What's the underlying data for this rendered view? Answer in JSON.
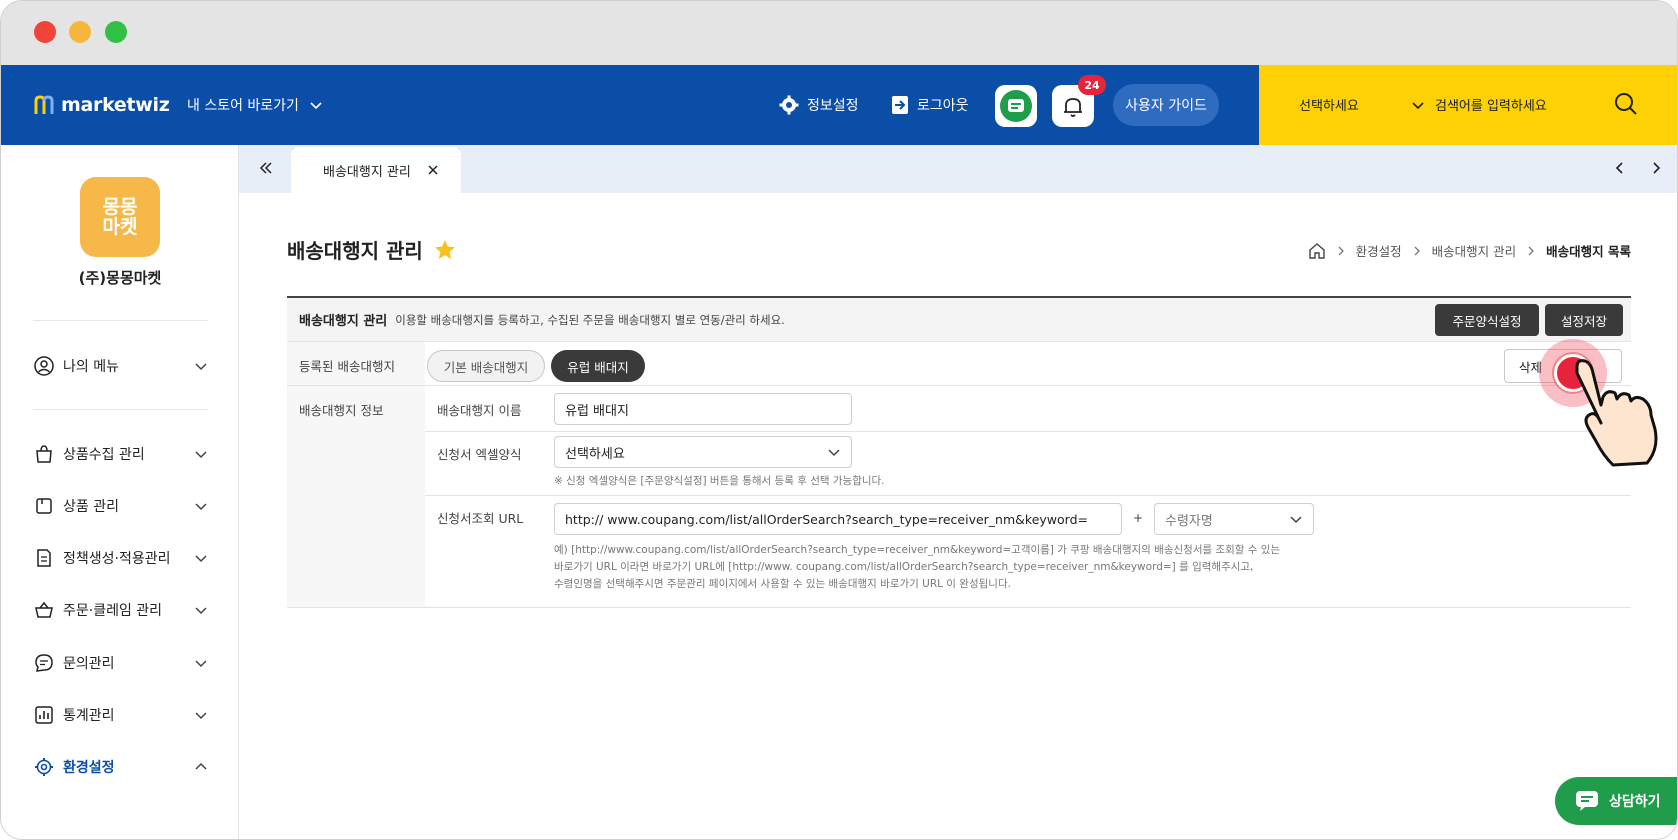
{
  "header": {
    "logo_text": "marketwiz",
    "store_link": "내 스토어 바로가기",
    "info_settings": "정보설정",
    "logout": "로그아웃",
    "notification_count": "24",
    "user_guide": "사용자 가이드",
    "search_select": "선택하세요",
    "search_placeholder": "검색어를 입력하세요"
  },
  "sidebar": {
    "store_logo_text": "몽몽마켓",
    "store_name": "(주)몽몽마켓",
    "my_menu": "나의 메뉴",
    "items": [
      {
        "label": "상품수집 관리",
        "icon": "bag-icon"
      },
      {
        "label": "상품 관리",
        "icon": "box-icon"
      },
      {
        "label": "정책생성·적용관리",
        "icon": "document-icon"
      },
      {
        "label": "주문·클레임 관리",
        "icon": "basket-icon"
      },
      {
        "label": "문의관리",
        "icon": "chat-bubble-icon"
      },
      {
        "label": "통계관리",
        "icon": "bar-chart-icon"
      },
      {
        "label": "환경설정",
        "icon": "gear-icon",
        "active": true
      }
    ]
  },
  "tabs": {
    "active_tab": "배송대행지 관리"
  },
  "page": {
    "title": "배송대행지 관리",
    "breadcrumb": [
      "환경설정",
      "배송대행지 관리",
      "배송대행지 목록"
    ]
  },
  "panel": {
    "heading": "배송대행지 관리",
    "description": "이용할 배송대행지를 등록하고, 수집된 주문을 배송대행지 별로 연동/관리 하세요.",
    "order_format_button": "주문양식설정",
    "save_button": "설정저장",
    "registered_label": "등록된 배송대행지",
    "chip_default": "기본 배송대행지",
    "chip_active": "유럽 배대지",
    "delete_button": "삭제",
    "info_label": "배송대행지 정보",
    "name_label": "배송대행지 이름",
    "name_value": "유럽 배대지",
    "excel_label": "신청서 엑셀양식",
    "excel_value": "선택하세요",
    "excel_help": "※ 신청 엑셀양식은 [주문양식설정] 버튼을 통해서 등록 후 선택 가능합니다.",
    "url_label": "신청서조회 URL",
    "url_value": "http:// www.coupang.com/list/allOrderSearch?search_type=receiver_nm&keyword=",
    "plus": "+",
    "recipient_select": "수령자명",
    "url_help_1": "예) [http://www.coupang.com/list/allOrderSearch?search_type=receiver_nm&keyword=고객이름] 가 쿠팡 배송대행지의 배송신청서를 조회할 수 있는",
    "url_help_2": "바로가기 URL 이라면 바로가기 URL에 [http://www. coupang.com/list/allOrderSearch?search_type=receiver_nm&keyword=] 를 입력해주시고,",
    "url_help_3": "수령인명을 선택해주시면 주문관리 페이지에서 사용할 수 있는 배송대행지 바로가기 URL 이 완성됩니다."
  },
  "floating": {
    "consult_button": "상담하기"
  },
  "colors": {
    "header_blue": "#0b4ea8",
    "search_yellow": "#fdd103",
    "dark_button": "#3a3a3a",
    "consult_green": "#1f9d4a",
    "badge_red": "#e8243c"
  }
}
